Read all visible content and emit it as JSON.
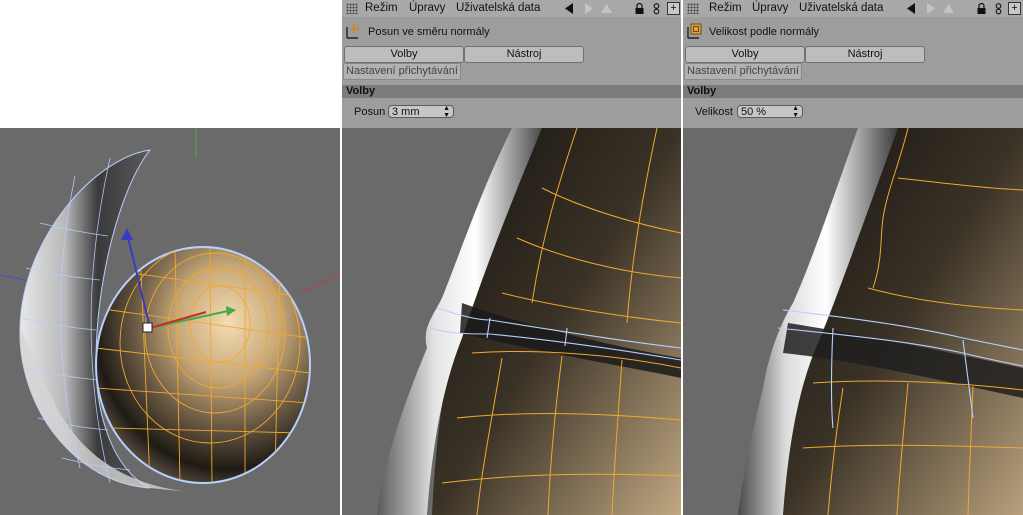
{
  "panels": [
    {
      "menu": {
        "mode": "Režim",
        "edit": "Úpravy",
        "user_data": "Uživatelská data"
      },
      "tool_title": "Posun ve směru normály",
      "tabs": {
        "options": "Volby",
        "tool": "Nástroj"
      },
      "snap_label": "Nastavení přichytávání",
      "section_title": "Volby",
      "field_label": "Posun",
      "field_value": "3 mm"
    },
    {
      "menu": {
        "mode": "Režim",
        "edit": "Úpravy",
        "user_data": "Uživatelská data"
      },
      "tool_title": "Velikost podle normály",
      "tabs": {
        "options": "Volby",
        "tool": "Nástroj"
      },
      "snap_label": "Nastavení přichytávání",
      "section_title": "Volby",
      "field_label": "Velikost",
      "field_value": "50 %"
    }
  ],
  "viewport": {
    "background": "#6a6a6a",
    "wire_color": "#f0a830",
    "edge_color": "#b8d0ff"
  }
}
